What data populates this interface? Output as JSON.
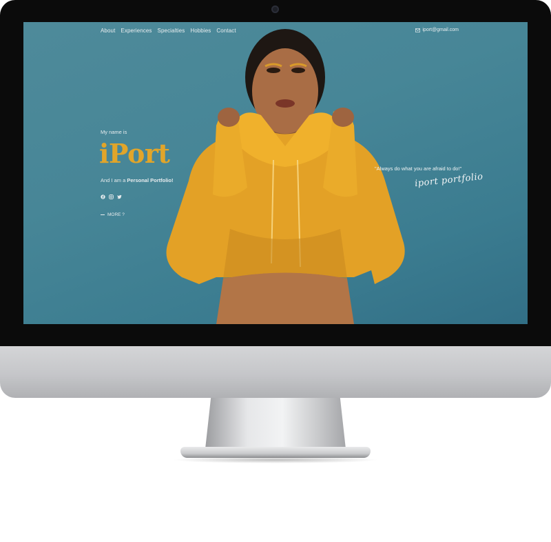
{
  "nav": {
    "items": [
      "About",
      "Experiences",
      "Specialties",
      "Hobbies",
      "Contact"
    ],
    "email": "iport@gmail.com"
  },
  "hero": {
    "intro": "My name is",
    "brand": "iPort",
    "tagline_prefix": "And I am a ",
    "tagline_highlight": "Personal Portfolio!",
    "more_label": "MORE ?",
    "quote": "\"Always do what you are afraid to do!\"",
    "signature": "iport portfolio"
  },
  "social": [
    "facebook-icon",
    "instagram-icon",
    "twitter-icon"
  ],
  "colors": {
    "accent": "#e1a52a",
    "screen_bg": "#47879a",
    "bezel": "#0b0b0b",
    "hoodie": "#e3a126"
  }
}
